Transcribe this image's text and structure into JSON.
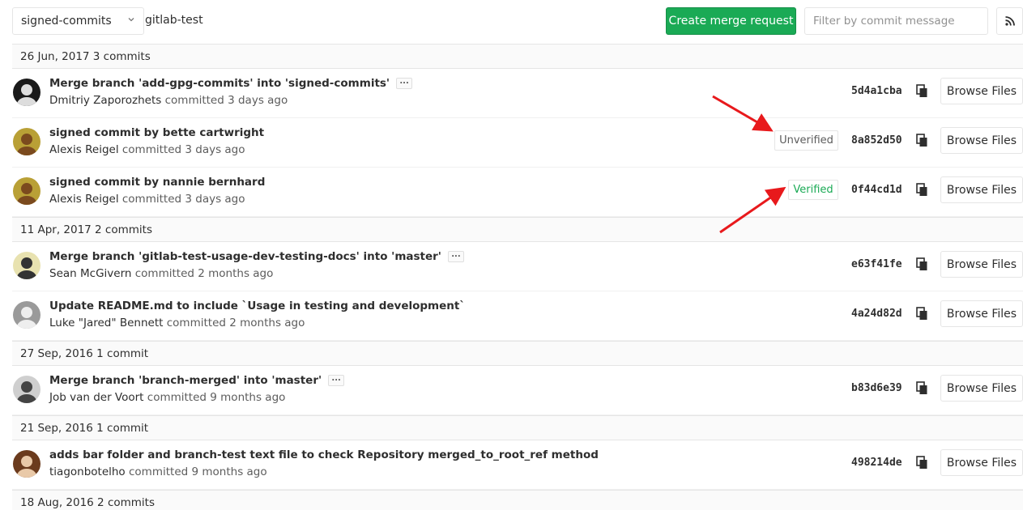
{
  "toolbar": {
    "branch": "signed-commits",
    "path": "gitlab-test",
    "create_mr_label": "Create merge request",
    "filter_placeholder": "Filter by commit message"
  },
  "groups": [
    {
      "header": "26 Jun, 2017 3 commits",
      "commits": [
        {
          "title": "Merge branch 'add-gpg-commits' into 'signed-commits'",
          "expand": "...",
          "author": "Dmitriy Zaporozhets",
          "action": "committed",
          "time": "3 days ago",
          "sha": "5d4a1cba",
          "signature": "",
          "browse": "Browse Files"
        },
        {
          "title": "signed commit by bette cartwright",
          "expand": "",
          "author": "Alexis Reigel",
          "action": "committed",
          "time": "3 days ago",
          "sha": "8a852d50",
          "signature": "Unverified",
          "browse": "Browse Files"
        },
        {
          "title": "signed commit by nannie bernhard",
          "expand": "",
          "author": "Alexis Reigel",
          "action": "committed",
          "time": "3 days ago",
          "sha": "0f44cd1d",
          "signature": "Verified",
          "browse": "Browse Files"
        }
      ]
    },
    {
      "header": "11 Apr, 2017 2 commits",
      "commits": [
        {
          "title": "Merge branch 'gitlab-test-usage-dev-testing-docs' into 'master'",
          "expand": "...",
          "author": "Sean McGivern",
          "action": "committed",
          "time": "2 months ago",
          "sha": "e63f41fe",
          "signature": "",
          "browse": "Browse Files"
        },
        {
          "title": "Update README.md to include `Usage in testing and development`",
          "expand": "",
          "author": "Luke \"Jared\" Bennett",
          "action": "committed",
          "time": "2 months ago",
          "sha": "4a24d82d",
          "signature": "",
          "browse": "Browse Files"
        }
      ]
    },
    {
      "header": "27 Sep, 2016 1 commit",
      "commits": [
        {
          "title": "Merge branch 'branch-merged' into 'master'",
          "expand": "...",
          "author": "Job van der Voort",
          "action": "committed",
          "time": "9 months ago",
          "sha": "b83d6e39",
          "signature": "",
          "browse": "Browse Files"
        }
      ]
    },
    {
      "header": "21 Sep, 2016 1 commit",
      "commits": [
        {
          "title": "adds bar folder and branch-test text file to check Repository merged_to_root_ref method",
          "expand": "",
          "author": "tiagonbotelho",
          "action": "committed",
          "time": "9 months ago",
          "sha": "498214de",
          "signature": "",
          "browse": "Browse Files"
        }
      ]
    },
    {
      "header": "18 Aug, 2016 2 commits",
      "commits": []
    }
  ],
  "colors": {
    "success": "#1aaa55",
    "annotation": "#e8191c"
  }
}
